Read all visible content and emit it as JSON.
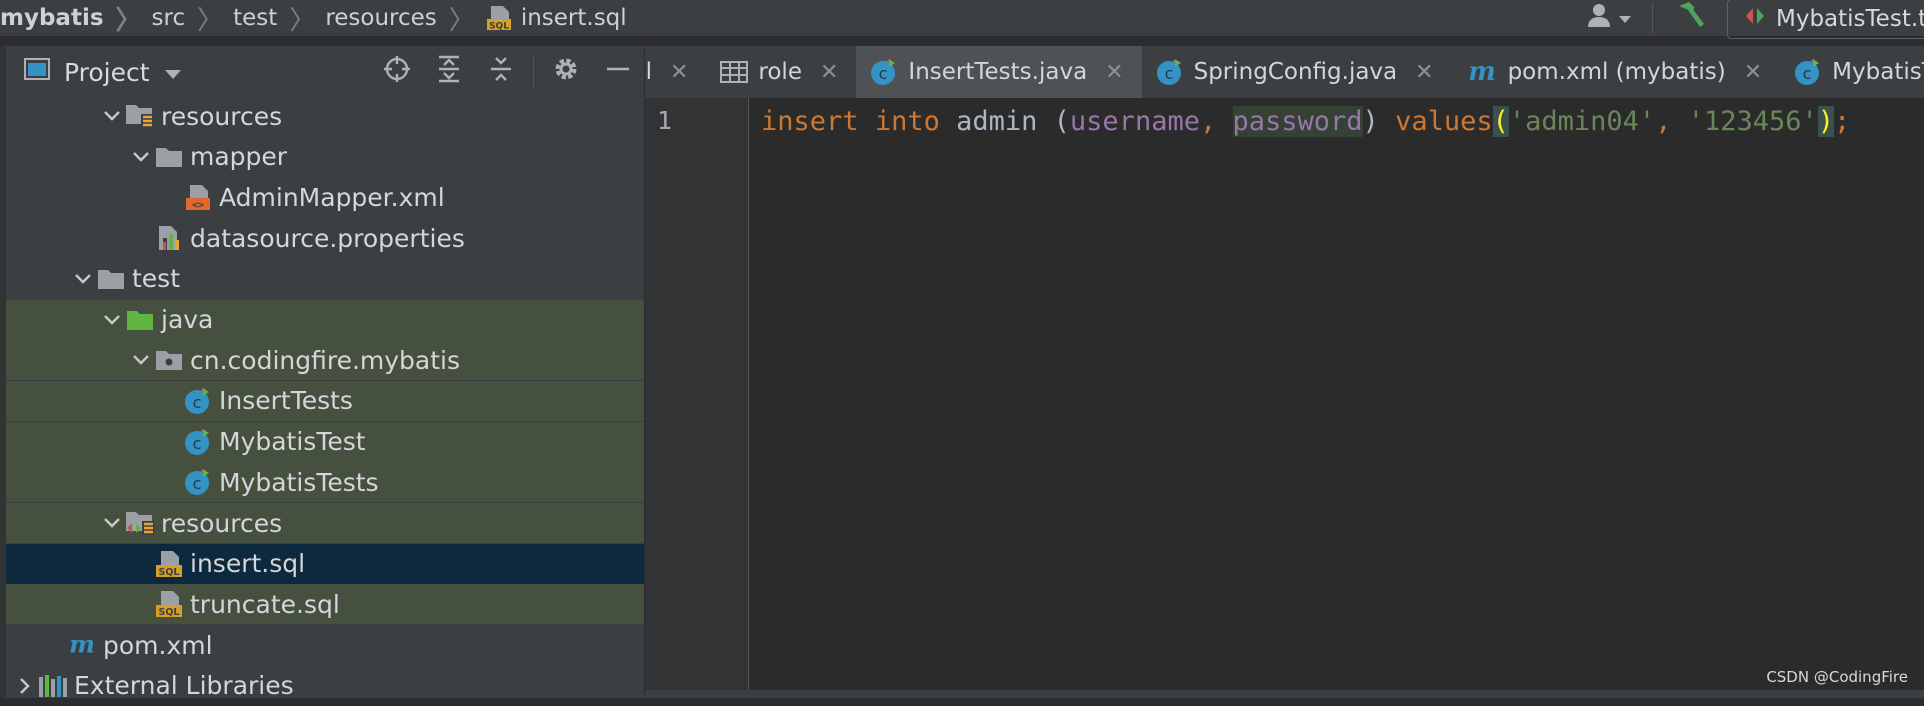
{
  "breadcrumbs": [
    "mybatis",
    "src",
    "test",
    "resources",
    "insert.sql"
  ],
  "run_config": "MybatisTest.te",
  "project_panel": {
    "title": "Project",
    "tree": [
      {
        "label": "resources",
        "indent": 1,
        "arrow": "down",
        "icon": "resources-folder-icon",
        "state": "normal"
      },
      {
        "label": "mapper",
        "indent": 2,
        "arrow": "down",
        "icon": "folder-icon",
        "state": "normal"
      },
      {
        "label": "AdminMapper.xml",
        "indent": 3,
        "arrow": "",
        "icon": "xml-file-icon",
        "state": "normal"
      },
      {
        "label": "datasource.properties",
        "indent": 2,
        "arrow": "",
        "icon": "properties-file-icon",
        "state": "normal"
      },
      {
        "label": "test",
        "indent": 0,
        "arrow": "down",
        "icon": "folder-icon",
        "state": "normal"
      },
      {
        "label": "java",
        "indent": 1,
        "arrow": "down",
        "icon": "green-folder-icon",
        "state": "green"
      },
      {
        "label": "cn.codingfire.mybatis",
        "indent": 2,
        "arrow": "down",
        "icon": "package-icon",
        "state": "green"
      },
      {
        "label": "InsertTests",
        "indent": 3,
        "arrow": "",
        "icon": "class-icon",
        "state": "green"
      },
      {
        "label": "MybatisTest",
        "indent": 3,
        "arrow": "",
        "icon": "class-icon",
        "state": "green"
      },
      {
        "label": "MybatisTests",
        "indent": 3,
        "arrow": "",
        "icon": "class-icon",
        "state": "green"
      },
      {
        "label": "resources",
        "indent": 1,
        "arrow": "down",
        "icon": "test-resources-folder-icon",
        "state": "green"
      },
      {
        "label": "insert.sql",
        "indent": 2,
        "arrow": "",
        "icon": "sql-file-icon",
        "state": "selected"
      },
      {
        "label": "truncate.sql",
        "indent": 2,
        "arrow": "",
        "icon": "sql-file-icon",
        "state": "green"
      },
      {
        "label": "pom.xml",
        "indent": -1,
        "arrow": "",
        "icon": "maven-icon",
        "state": "normal"
      },
      {
        "label": "External Libraries",
        "indent": -2,
        "arrow": "right",
        "icon": "libraries-icon",
        "state": "normal"
      }
    ]
  },
  "tabs": [
    {
      "label": "nl",
      "icon": "",
      "active": false
    },
    {
      "label": "role",
      "icon": "table-icon",
      "active": false
    },
    {
      "label": "InsertTests.java",
      "icon": "class-icon",
      "active": true
    },
    {
      "label": "SpringConfig.java",
      "icon": "class-icon",
      "active": false
    },
    {
      "label": "pom.xml (mybatis)",
      "icon": "maven-icon",
      "active": false
    },
    {
      "label": "MybatisTest.java",
      "icon": "class-icon",
      "active": false
    }
  ],
  "editor": {
    "line_number": "1",
    "code": {
      "kw1": "insert",
      "kw2": "into",
      "table": "admin",
      "open": "(",
      "col1": "username",
      "comma1": ",",
      "col2": "password",
      "close": ")",
      "kw3": "values",
      "vopen": "(",
      "str1": "'admin04'",
      "comma2": ",",
      "str2": "'123456'",
      "vclose": ")",
      "semi": ";"
    }
  },
  "watermark": "CSDN @CodingFire"
}
